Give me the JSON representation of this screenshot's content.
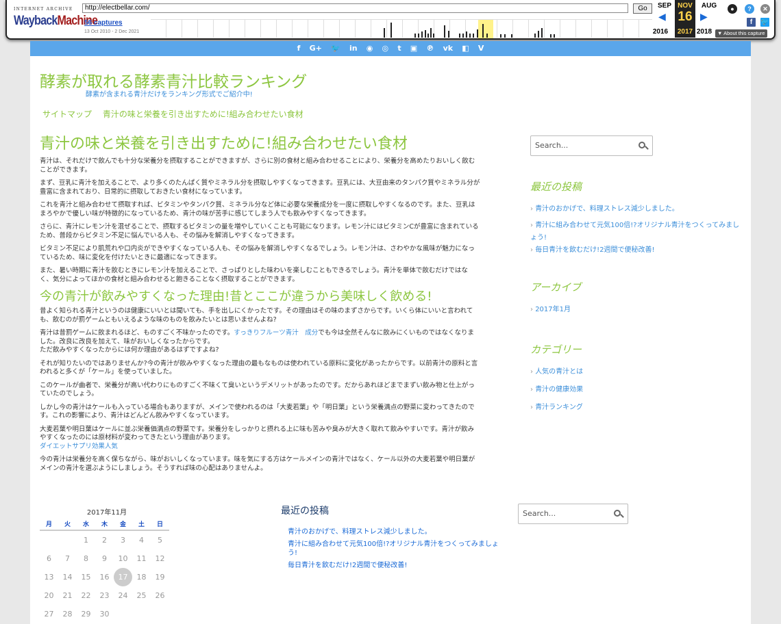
{
  "wayback": {
    "brand_small": "INTERNET ARCHIVE",
    "brand_1": "Wayback",
    "brand_2": "Machine",
    "url": "http://electbellar.com/",
    "go": "Go",
    "captures": "56 captures",
    "range": "13 Oct 2010 - 2 Dec 2021",
    "prev_month": "SEP",
    "cur_month": "NOV",
    "next_month": "AUG",
    "cur_day": "16",
    "prev_year": "2016",
    "cur_year": "2017",
    "next_year": "2018",
    "about": "▼ About this capture",
    "help": "?",
    "close": "✕",
    "fb": "f"
  },
  "social_icons": [
    "f",
    "G+",
    "🐦",
    "in",
    "◉",
    "◎",
    "t",
    "▣",
    "℗",
    "vk",
    "◧",
    "V"
  ],
  "site": {
    "title": "酵素が取れる酵素青汁比較ランキング",
    "description": "酵素が含まれる青汁だけをランキング形式でご紹介中!",
    "nav": [
      "サイトマップ",
      "青汁の味と栄養を引き出すために!組み合わせたい食材"
    ]
  },
  "article": {
    "h1": "青汁の味と栄養を引き出すために!組み合わせたい食材",
    "p1": "青汁は、それだけで飲んでも十分な栄養分を摂取することができますが、さらに別の食材と組み合わせることにより、栄養分を高めたりおいしく飲むことができます。",
    "p2": "まず、豆乳に青汁を加えることで、より多くのたんぱく質やミネラル分を摂取しやすくなってきます。豆乳には、大豆由来のタンパク質やミネラル分が豊富に含まれており、日常的に摂取しておきたい食材になっています。",
    "p3": "これを青汁と組み合わせて摂取すれば、ビタミンやタンパク質、ミネラル分など体に必要な栄養成分を一度に摂取しやすくなるのです。また、豆乳はまろやかで優しい味が特徴的になっているため、青汁の味が苦手に感じてしまう人でも飲みやすくなってきます。",
    "p4": "さらに、青汁にレモン汁を混ぜることで、摂取するビタミンの量を増やしていくことも可能になります。レモン汁にはビタミンCが豊富に含まれているため、普段からビタミン不足に悩んでいる人も、その悩みを解消しやすくなってきます。",
    "p5": "ビタミン不足により肌荒れや口内炎ができやすくなっている人も、その悩みを解消しやすくなるでしょう。レモン汁は、さわやかな風味が魅力になっているため、味に変化を付けたいときに最適になってきます。",
    "p6": "また、暑い時期に青汁を飲むときにレモン汁を加えることで、さっぱりとした味わいを楽しむこともできるでしょう。青汁を単体で飲むだけではなく、気分によってほかの食材と組み合わせると飽きることなく摂取することができます。",
    "h2": "今の青汁が飲みやすくなった理由!昔とここが違うから美味しく飲める!",
    "q1": "昔よく知られる青汁というのは健康にいいとは聞いても、手を出しにくかったです。その理由はその味のまずさからです。いくら体にいいと言われても、飲むのが罰ゲームともいえるような味のものを飲みたいとは思いませんよね?",
    "q2a": "青汁は昔罰ゲームに飲まれるほど、ものすごく不味かったのです。",
    "q2link": "すっきりフルーツ青汁　成分",
    "q2b": "でも今は全然そんなに飲みにくいものではなくなりました。改良に改良を加えて、味がおいしくなったからです。",
    "q2c": "ただ飲みやすくなったからには何か理由があるはずですよね?",
    "q3": "それが知りたいのではありませんか?今の青汁が飲みやすくなった理由の最もなものは使われている原料に変化があったからです。以前青汁の原料と言われると多くが「ケール」を使っていました。",
    "q4": "このケールが曲者で、栄養分が高い代わりにものすごく不味くて臭いというデメリットがあったのです。だからあれほどまでまずい飲み物と仕上がっていたのでしょう。",
    "q5": "しかし今の青汁はケールも入っている場合もありますが、メインで使われるのは「大麦若葉」や「明日葉」という栄養満点の野菜に変わってきたのです。これの影響により、青汁はどんどん飲みやすくなっています。",
    "q6": "大麦若葉や明日葉はケールに並ぶ栄養価満点の野菜です。栄養分をしっかりと摂れる上に味も苦みや臭みが大きく取れて飲みやすいです。青汁が飲みやすくなったのには原材料が変わってきたという理由があります。",
    "q6link": "ダイエットサプリ効果人気",
    "q7": "今の青汁は栄養分を高く保ちながら、味がおいしくなっています。味を気にする方はケールメインの青汁ではなく、ケール以外の大麦若葉や明日葉がメインの青汁を選ぶようにしましょう。そうすれば味の心配はありませんよ。"
  },
  "sidebar": {
    "search_placeholder": "Search...",
    "recent_title": "最近の投稿",
    "recent": [
      "青汁のおかげで、料理ストレス減少しました。",
      "青汁に組み合わせて元気100倍!?オリジナル青汁をつくってみましょう!",
      "毎日青汁を飲むだけ!2週間で便秘改善!"
    ],
    "archive_title": "アーカイブ",
    "archives": [
      "2017年1月"
    ],
    "category_title": "カテゴリー",
    "categories": [
      "人気の青汁とは",
      "青汁の健康効果",
      "青汁ランキング"
    ]
  },
  "calendar": {
    "caption": "2017年11月",
    "weekdays": [
      "月",
      "火",
      "水",
      "木",
      "金",
      "土",
      "日"
    ],
    "rows": [
      [
        "",
        "",
        "1",
        "2",
        "3",
        "4",
        "5"
      ],
      [
        "6",
        "7",
        "8",
        "9",
        "10",
        "11",
        "12"
      ],
      [
        "13",
        "14",
        "15",
        "16",
        "17",
        "18",
        "19"
      ],
      [
        "20",
        "21",
        "22",
        "23",
        "24",
        "25",
        "26"
      ],
      [
        "27",
        "28",
        "29",
        "30",
        "",
        "",
        ""
      ]
    ],
    "today": "17"
  },
  "footer": {
    "recent_title": "最近の投稿",
    "recent": [
      "青汁のおかげで、料理ストレス減少しました。",
      "青汁に組み合わせて元気100倍!?オリジナル青汁をつくってみましょう!",
      "毎日青汁を飲むだけ!2週間で便秘改善!"
    ],
    "search_placeholder": "Search..."
  }
}
